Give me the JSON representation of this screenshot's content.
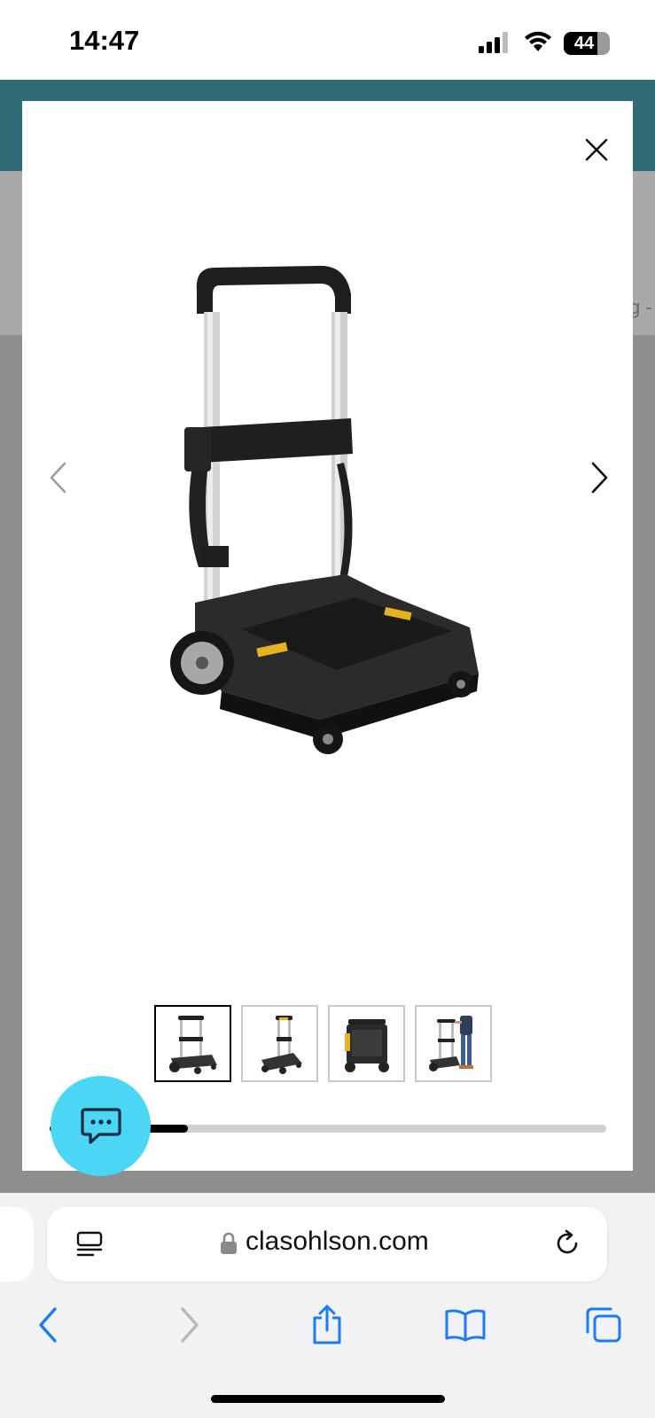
{
  "status_bar": {
    "time": "14:47",
    "battery_level": "44",
    "icons": [
      "signal-icon",
      "wifi-icon",
      "battery-icon"
    ]
  },
  "background_page": {
    "peek_text": "g -"
  },
  "gallery_modal": {
    "product_image": "tool-trolley",
    "thumbnails": [
      {
        "image": "trolley-front-view",
        "selected": true
      },
      {
        "image": "trolley-side-view",
        "selected": false
      },
      {
        "image": "trolley-with-box-view",
        "selected": false
      },
      {
        "image": "trolley-in-use-view",
        "selected": false
      }
    ],
    "scroll_progress": 0.15,
    "icons": [
      "close-icon",
      "chevron-left-icon",
      "chevron-right-icon"
    ]
  },
  "chat": {
    "icon": "chat-bubble-icon",
    "color": "#4cd6f5"
  },
  "browser": {
    "url": "clasohlson.com",
    "icons": [
      "reader-mode-icon",
      "lock-icon",
      "reload-icon"
    ],
    "toolbar": [
      "back-icon",
      "forward-icon",
      "share-icon",
      "bookmarks-icon",
      "tabs-icon"
    ],
    "accent": "#1a7cf5"
  },
  "colors": {
    "header_teal": "#2f6c77",
    "overlay_gray": "#8e8e8e"
  }
}
